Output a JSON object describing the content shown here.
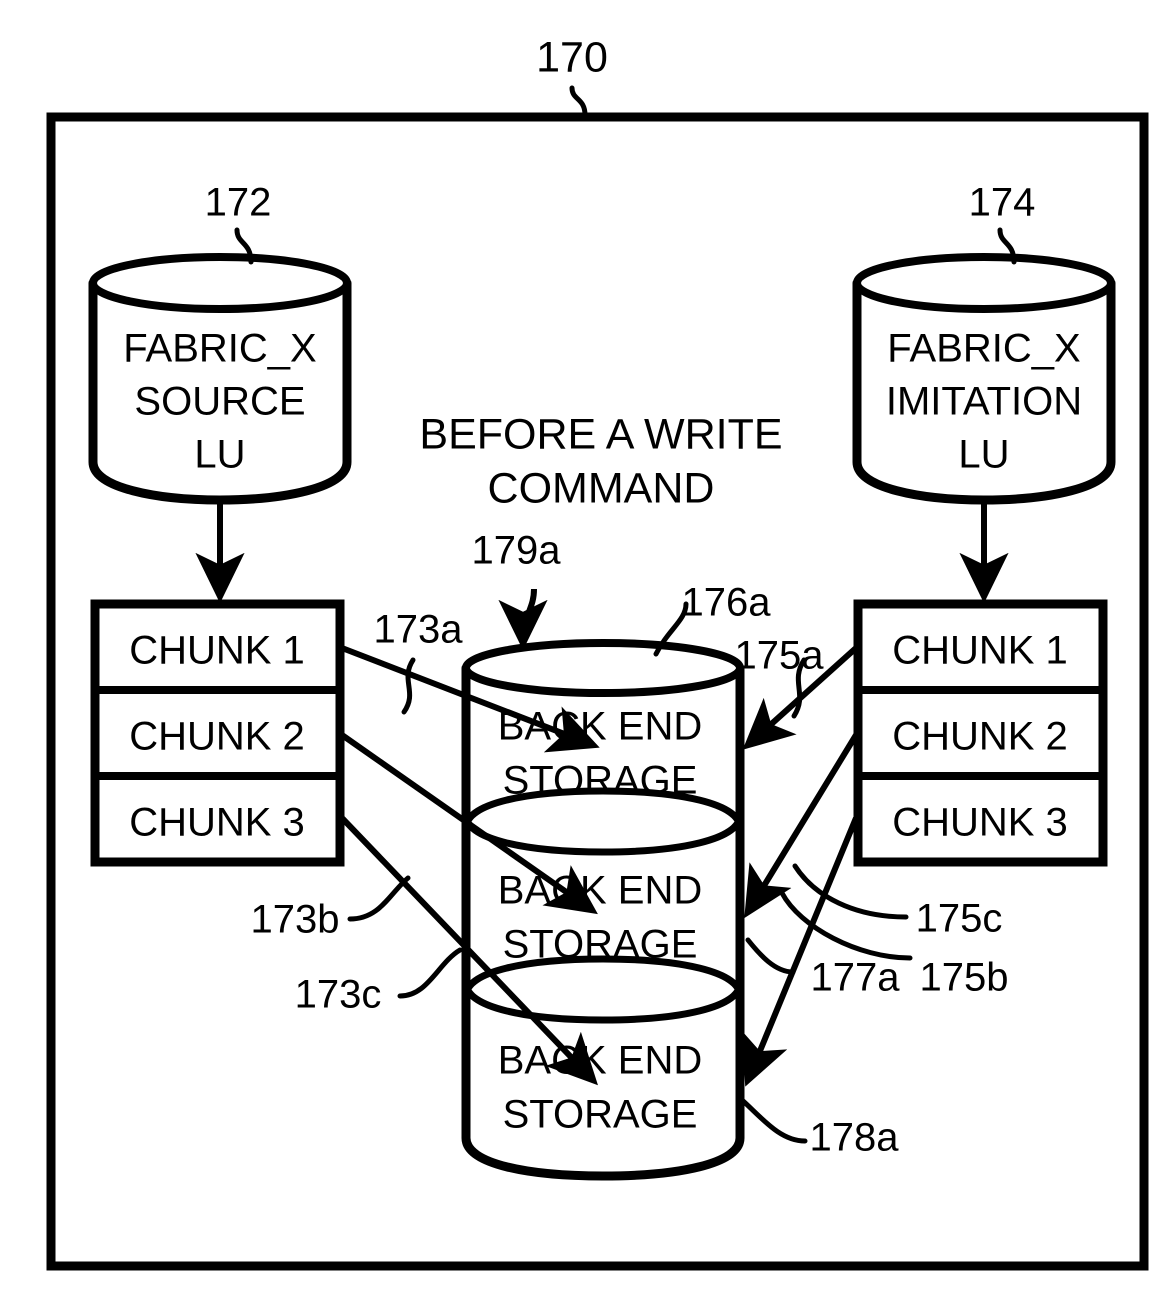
{
  "figure": {
    "figure_ref": "170",
    "caption_line1": "BEFORE A WRITE",
    "caption_line2": "COMMAND"
  },
  "source_lu": {
    "ref": "172",
    "line1": "FABRIC_X",
    "line2": "SOURCE",
    "line3": "LU"
  },
  "imitation_lu": {
    "ref": "174",
    "line1": "FABRIC_X",
    "line2": "IMITATION",
    "line3": "LU"
  },
  "left_chunks": {
    "rows": [
      {
        "label": "CHUNK 1"
      },
      {
        "label": "CHUNK 2"
      },
      {
        "label": "CHUNK 3"
      }
    ]
  },
  "right_chunks": {
    "rows": [
      {
        "label": "CHUNK 1"
      },
      {
        "label": "CHUNK 2"
      },
      {
        "label": "CHUNK 3"
      }
    ]
  },
  "back_end_storage": {
    "segments": [
      {
        "line1": "BACK END",
        "line2": "STORAGE"
      },
      {
        "line1": "BACK END",
        "line2": "STORAGE"
      },
      {
        "line1": "BACK END",
        "line2": "STORAGE"
      }
    ],
    "refs": {
      "top": "176a",
      "middle": "177a",
      "bottom": "178a",
      "stack": "179a"
    }
  },
  "left_mapping_refs": [
    {
      "id": "173a"
    },
    {
      "id": "173b"
    },
    {
      "id": "173c"
    }
  ],
  "right_mapping_refs": [
    {
      "id": "175a"
    },
    {
      "id": "175b"
    },
    {
      "id": "175c"
    }
  ],
  "colors": {
    "ink": "#000000",
    "paper": "#ffffff"
  }
}
